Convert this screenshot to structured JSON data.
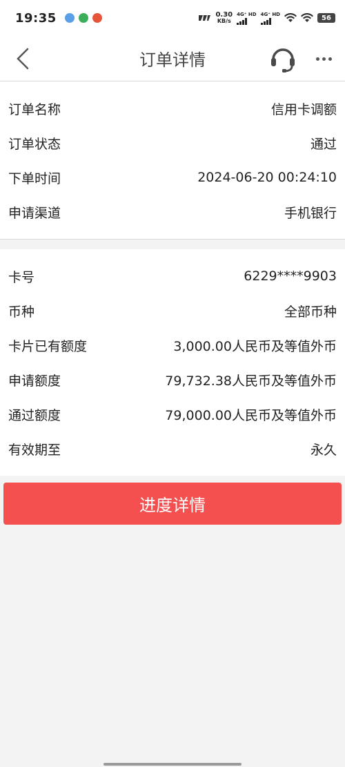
{
  "status_bar": {
    "time": "19:35",
    "speed_value": "0.30",
    "speed_unit": "KB/s",
    "sim1": "4G⁺ HD",
    "sim2": "4G⁺ HD",
    "battery": "56"
  },
  "header": {
    "title": "订单详情"
  },
  "order_info": [
    {
      "label": "订单名称",
      "value": "信用卡调额"
    },
    {
      "label": "订单状态",
      "value": "通过"
    },
    {
      "label": "下单时间",
      "value": "2024-06-20 00:24:10"
    },
    {
      "label": "申请渠道",
      "value": "手机银行"
    }
  ],
  "card_info": [
    {
      "label": "卡号",
      "value": "6229****9903"
    },
    {
      "label": "币种",
      "value": "全部币种"
    },
    {
      "label": "卡片已有额度",
      "value": "3,000.00人民币及等值外币"
    },
    {
      "label": "申请额度",
      "value": "79,732.38人民币及等值外币"
    },
    {
      "label": "通过额度",
      "value": "79,000.00人民币及等值外币"
    },
    {
      "label": "有效期至",
      "value": "永久"
    }
  ],
  "actions": {
    "progress_label": "进度详情"
  },
  "colors": {
    "accent": "#f55050",
    "background": "#f3f3f3",
    "surface": "#ffffff"
  },
  "icons": [
    "back-arrow-icon",
    "headset-icon",
    "more-dots-icon"
  ]
}
